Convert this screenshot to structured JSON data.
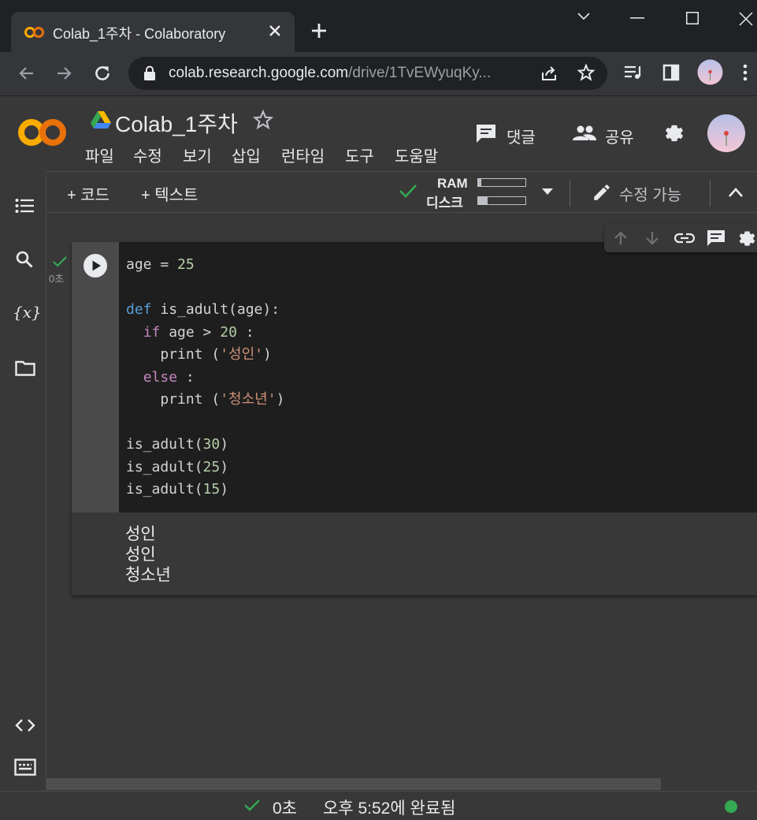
{
  "browser": {
    "tab_title": "Colab_1주차 - Colaboratory",
    "url_host": "colab.research.google.com",
    "url_path": "/drive/1TvEWyuqKy...",
    "new_tab": "+"
  },
  "colab": {
    "doc_title": "Colab_1주차",
    "menu": [
      "파일",
      "수정",
      "보기",
      "삽입",
      "런타임",
      "도구",
      "도움말"
    ],
    "comment_label": "댓글",
    "share_label": "공유",
    "add_code": "+ 코드",
    "add_text": "+ 텍스트",
    "ram_label": "RAM",
    "disk_label": "디스크",
    "ram_usage": 0.06,
    "disk_usage": 0.2,
    "edit_mode": "수정 가능"
  },
  "cell": {
    "exec_time": "0초",
    "output_lines": [
      "성인",
      "성인",
      "청소년"
    ]
  },
  "status": {
    "duration": "0초",
    "completed": "오후 5:52에 완료됨"
  },
  "colors": {
    "accent_green": "#34a853",
    "colab_orange": "#f9ab00",
    "colab_dark_orange": "#e8710a"
  },
  "icons": [
    "back-icon",
    "forward-icon",
    "reload-icon",
    "lock-icon",
    "share-page-icon",
    "bookmark-star-icon",
    "reading-list-icon",
    "side-panel-icon",
    "profile-avatar",
    "more-icon",
    "colab-logo",
    "drive-icon",
    "star-icon",
    "comment-icon",
    "people-icon",
    "gear-icon",
    "toc-icon",
    "search-icon",
    "variables-icon",
    "folder-icon",
    "code-snippets-icon",
    "terminal-icon",
    "run-icon",
    "move-up-icon",
    "move-down-icon",
    "link-icon",
    "cell-comment-icon",
    "cell-settings-icon",
    "pencil-icon",
    "collapse-icon",
    "check-icon"
  ]
}
